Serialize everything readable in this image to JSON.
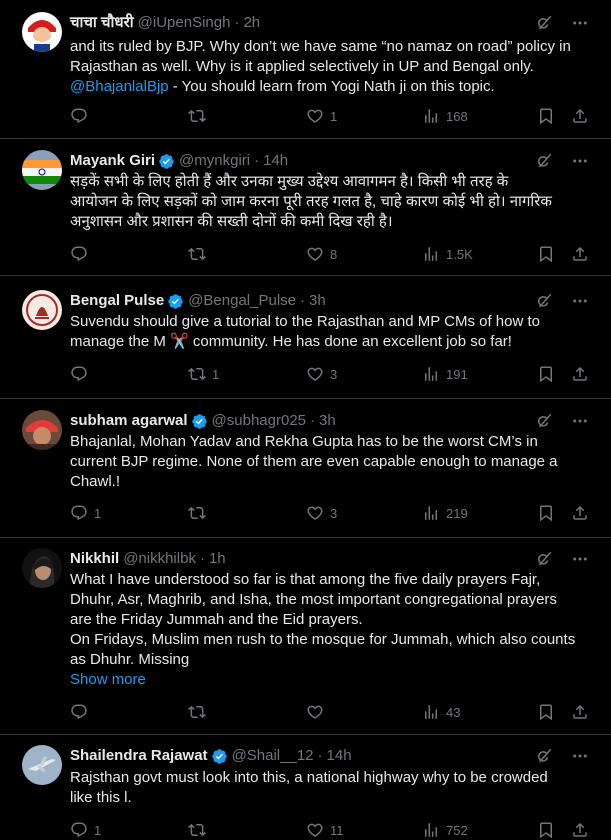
{
  "colors": {
    "background": "#000000",
    "text": "#e7e9ea",
    "muted": "#71767b",
    "accent": "#1d9bf0",
    "divider": "#2f3336"
  },
  "icons": {
    "reply": "reply-icon",
    "retweet": "retweet-icon",
    "like": "like-icon",
    "views": "views-icon",
    "bookmark": "bookmark-icon",
    "share": "share-icon",
    "grok": "grok-icon",
    "more": "more-icon",
    "verified": "verified-badge-icon"
  },
  "tweets": [
    {
      "name": "चाचा चौधरी",
      "verified": false,
      "handle": "@iUpenSingh",
      "time": "2h",
      "lines": [
        "and its ruled by BJP. Why don’t we have same “no namaz on road” policy in",
        "Rajasthan as well. Why is it applied selectively in UP and Bengal only."
      ],
      "mention": "@BhajanlalBjp",
      "mention_tail": " - You should learn from Yogi Nath ji on this topic.",
      "replies": "",
      "retweets": "",
      "likes": "1",
      "views": "168"
    },
    {
      "name": "Mayank Giri",
      "verified": true,
      "handle": "@mynkgiri",
      "time": "14h",
      "lines": [
        "सड़कें सभी के लिए होती हैं और उनका मुख्य उद्देश्य आवागमन है। किसी भी तरह के",
        "आयोजन के लिए सड़कों को जाम करना पूरी तरह गलत है, चाहे कारण कोई भी हो। नागरिक",
        "अनुशासन और प्रशासन की सख्ती दोनों की कमी दिख रही है।"
      ],
      "replies": "",
      "retweets": "",
      "likes": "8",
      "views": "1.5K"
    },
    {
      "name": "Bengal Pulse",
      "verified": true,
      "handle": "@Bengal_Pulse",
      "time": "3h",
      "lines": [
        "Suvendu should give a tutorial to the Rajasthan and MP CMs of how to",
        "manage the M ✂️ community. He has done an excellent job so far!"
      ],
      "replies": "",
      "retweets": "1",
      "likes": "3",
      "views": "191"
    },
    {
      "name": "subham agarwal",
      "verified": true,
      "handle": "@subhagr025",
      "time": "3h",
      "lines": [
        "Bhajanlal, Mohan Yadav and Rekha Gupta has to be the worst CM’s in",
        "current BJP regime. None of them are even capable enough to manage a",
        "Chawl.!"
      ],
      "replies": "1",
      "retweets": "",
      "likes": "3",
      "views": "219"
    },
    {
      "name": "Nikkhil",
      "verified": false,
      "handle": "@nikkhilbk",
      "time": "1h",
      "lines": [
        "What I have understood so far is that among the five daily prayers Fajr,",
        "Dhuhr, Asr, Maghrib, and Isha, the most important congregational prayers",
        "are the Friday Jummah and the Eid prayers.",
        "On Fridays, Muslim men rush to the mosque for Jummah, which also counts",
        "as Dhuhr. Missing"
      ],
      "show_more": "Show more",
      "replies": "",
      "retweets": "",
      "likes": "",
      "views": "43"
    },
    {
      "name": "Shailendra Rajawat",
      "verified": true,
      "handle": "@Shail__12",
      "time": "14h",
      "lines": [
        "Rajsthan govt must look into this, a national highway why to be crowded",
        "like this l."
      ],
      "replies": "1",
      "retweets": "",
      "likes": "11",
      "views": "752"
    }
  ]
}
